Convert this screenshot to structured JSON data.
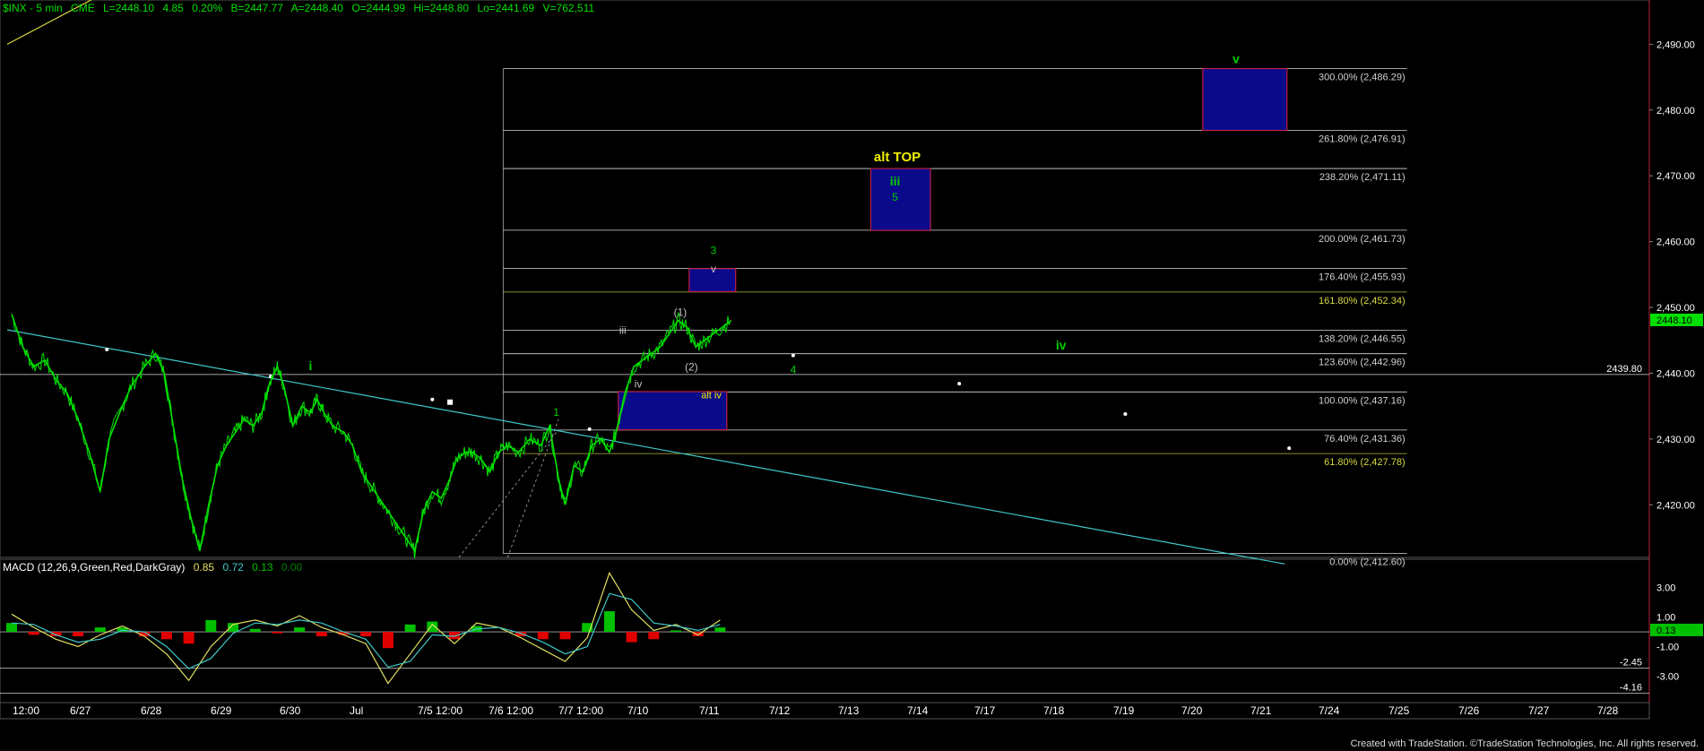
{
  "header": {
    "symbol": "$INX - 5 min",
    "exchange": "CME",
    "last": "L=2448.10",
    "change": "4.85",
    "pct": "0.20%",
    "bid": "B=2447.77",
    "ask": "A=2448.40",
    "open": "O=2444.99",
    "high": "Hi=2448.80",
    "low": "Lo=2441.69",
    "volume": "V=762,511"
  },
  "macd_header": {
    "label": "MACD (12,26,9,Green,Red,DarkGray)",
    "v1": "0.85",
    "v2": "0.72",
    "v3": "0.13",
    "v4": "0.00"
  },
  "credit": "Created with TradeStation. ©TradeStation Technologies, Inc. All rights reserved.",
  "colors": {
    "price": "#00e000",
    "trendline": "#3fc8c8",
    "yellowline": "#d8d840",
    "fib_line": "#ffffff",
    "fib_text": "#d0d0d0",
    "fib_gold": "#d8d840",
    "box_fill": "#0a0a8a",
    "box_border": "#c02040",
    "wave_green": "#00d000",
    "wave_gray": "#c0c0c0",
    "wave_yellow": "#f0f000",
    "macd_line": "#e0e060",
    "macd_signal": "#3fc8c8",
    "macd_pos": "#00c000",
    "macd_neg": "#e00000",
    "grid": "#3a3a3a",
    "price_tag": "#00e000"
  },
  "chart_data": [
    {
      "type": "line",
      "name": "price",
      "x_ticks": [
        "12:00",
        "6/27",
        "6/28",
        "6/29",
        "6/30",
        "Jul",
        "7/5 12:00",
        "7/6 12:00",
        "7/7 12:00",
        "7/10",
        "7/11",
        "7/12",
        "7/13",
        "7/14",
        "7/17",
        "7/18",
        "7/19",
        "7/20",
        "7/21",
        "7/24",
        "7/25",
        "7/26",
        "7/27",
        "7/28"
      ],
      "ylim": [
        2412,
        2494
      ],
      "y_ticks": [
        "2,420.00",
        "2,430.00",
        "2,440.00",
        "2,450.00",
        "2,460.00",
        "2,470.00",
        "2,480.00",
        "2,490.00"
      ],
      "y_tick_values": [
        2420,
        2430,
        2440,
        2450,
        2460,
        2470,
        2480,
        2490
      ],
      "last_price_tag": "2448.10",
      "last_price": 2448.1,
      "ref_tag": "2439.80",
      "ref_price": 2439.8,
      "price_path": [
        [
          0,
          2449
        ],
        [
          0.5,
          2444
        ],
        [
          1,
          2441
        ],
        [
          1.5,
          2442
        ],
        [
          2,
          2439
        ],
        [
          2.5,
          2437
        ],
        [
          3,
          2433
        ],
        [
          3.5,
          2428
        ],
        [
          4,
          2422
        ],
        [
          4.4,
          2430
        ],
        [
          5,
          2435
        ],
        [
          5.4,
          2438
        ],
        [
          6,
          2441
        ],
        [
          6.5,
          2443
        ],
        [
          6.9,
          2440
        ],
        [
          7.3,
          2432
        ],
        [
          7.7,
          2424
        ],
        [
          8.1,
          2418
        ],
        [
          8.5,
          2413
        ],
        [
          8.9,
          2420
        ],
        [
          9.3,
          2426
        ],
        [
          9.7,
          2429
        ],
        [
          10.1,
          2431
        ],
        [
          10.5,
          2433
        ],
        [
          10.9,
          2432
        ],
        [
          11.3,
          2434
        ],
        [
          11.6,
          2438
        ],
        [
          12.0,
          2441
        ],
        [
          12.3,
          2438
        ],
        [
          12.7,
          2432
        ],
        [
          13.1,
          2435
        ],
        [
          13.5,
          2434
        ],
        [
          13.8,
          2436
        ],
        [
          14.1,
          2434
        ],
        [
          14.5,
          2432
        ],
        [
          15.0,
          2431
        ],
        [
          15.4,
          2429
        ],
        [
          15.8,
          2425
        ],
        [
          16.2,
          2423
        ],
        [
          16.6,
          2421
        ],
        [
          17.0,
          2419
        ],
        [
          17.4,
          2417
        ],
        [
          17.8,
          2415
        ],
        [
          18.2,
          2413
        ],
        [
          18.6,
          2419
        ],
        [
          19.0,
          2422
        ],
        [
          19.4,
          2421
        ],
        [
          19.8,
          2424
        ],
        [
          20.1,
          2427
        ],
        [
          20.5,
          2428
        ],
        [
          20.8,
          2428
        ],
        [
          21.2,
          2427
        ],
        [
          21.6,
          2425
        ],
        [
          22.0,
          2428
        ],
        [
          22.4,
          2429
        ],
        [
          22.9,
          2428
        ],
        [
          23.4,
          2430
        ],
        [
          23.9,
          2429
        ],
        [
          24.3,
          2432
        ],
        [
          24.7,
          2424
        ],
        [
          25.0,
          2420
        ],
        [
          25.4,
          2426
        ],
        [
          25.8,
          2425
        ],
        [
          26.2,
          2429
        ],
        [
          26.6,
          2430
        ],
        [
          27.0,
          2428
        ],
        [
          27.3,
          2431
        ],
        [
          27.7,
          2437
        ],
        [
          28.1,
          2441
        ],
        [
          28.5,
          2442
        ],
        [
          28.9,
          2443
        ],
        [
          29.3,
          2444
        ],
        [
          29.7,
          2446
        ],
        [
          30.1,
          2448
        ],
        [
          30.5,
          2447
        ],
        [
          30.9,
          2444
        ],
        [
          31.3,
          2445
        ],
        [
          31.7,
          2446
        ],
        [
          32.1,
          2447
        ],
        [
          32.5,
          2448
        ]
      ],
      "yellow_line": [
        [
          -0.2,
          2490
        ],
        [
          15,
          2517
        ]
      ],
      "trendline": [
        [
          -0.2,
          2446.6
        ],
        [
          57.5,
          2411
        ]
      ],
      "trend_dots": [
        [
          4.3,
          2443.6
        ],
        [
          11.7,
          2439.5
        ],
        [
          19,
          2436
        ],
        [
          26.1,
          2431.5
        ],
        [
          35.3,
          2442.7
        ],
        [
          42.8,
          2438.4
        ],
        [
          50.3,
          2433.8
        ],
        [
          57.7,
          2428.6
        ]
      ],
      "white_square": [
        19.8,
        2435.6
      ],
      "dashed_lines": [
        [
          [
            20.2,
            2412
          ],
          [
            24.6,
            2431
          ]
        ],
        [
          [
            22.4,
            2412
          ],
          [
            24.7,
            2433
          ]
        ]
      ],
      "fib_left_x": 22.2,
      "fib_right_x": 61.2,
      "fib_levels": [
        {
          "label": "300.00% (2,486.29)",
          "price": 2486.29,
          "gold": false
        },
        {
          "label": "261.80% (2,476.91)",
          "price": 2476.91,
          "gold": false
        },
        {
          "label": "238.20% (2,471.11)",
          "price": 2471.11,
          "gold": false
        },
        {
          "label": "200.00% (2,461.73)",
          "price": 2461.73,
          "gold": false
        },
        {
          "label": "176.40% (2,455.93)",
          "price": 2455.93,
          "gold": false
        },
        {
          "label": "161.80% (2,452.34)",
          "price": 2452.34,
          "gold": true
        },
        {
          "label": "138.20% (2,446.55)",
          "price": 2446.55,
          "gold": false
        },
        {
          "label": "123.60% (2,442.96)",
          "price": 2442.96,
          "gold": false
        },
        {
          "label": "100.00% (2,437.16)",
          "price": 2437.16,
          "gold": false
        },
        {
          "label": "76.40% (2,431.36)",
          "price": 2431.36,
          "gold": false
        },
        {
          "label": "61.80% (2,427.78)",
          "price": 2427.78,
          "gold": true
        },
        {
          "label": "0.00% (2,412.60)",
          "price": 2412.6,
          "gold": false
        }
      ],
      "boxes": [
        {
          "x1": 30.6,
          "x2": 32.7,
          "y1": 2452.4,
          "y2": 2455.9
        },
        {
          "x1": 38.8,
          "x2": 41.5,
          "y1": 2461.7,
          "y2": 2471.1
        },
        {
          "x1": 53.8,
          "x2": 57.6,
          "y1": 2476.9,
          "y2": 2486.3
        },
        {
          "x1": 27.4,
          "x2": 32.3,
          "y1": 2431.4,
          "y2": 2437.2
        }
      ],
      "wave_labels": [
        {
          "text": "i",
          "x": 13.5,
          "y": 2440.5,
          "color": "green",
          "size": 14,
          "bold": true
        },
        {
          "text": "1",
          "x": 24.6,
          "y": 2433.5,
          "color": "green",
          "size": 12,
          "bold": false
        },
        {
          "text": "iii",
          "x": 27.6,
          "y": 2446,
          "color": "gray",
          "size": 12,
          "bold": false
        },
        {
          "text": "iv",
          "x": 28.3,
          "y": 2437.8,
          "color": "gray",
          "size": 12,
          "bold": false
        },
        {
          "text": "(1)",
          "x": 30.2,
          "y": 2448.7,
          "color": "gray",
          "size": 12,
          "bold": false
        },
        {
          "text": "(2)",
          "x": 30.7,
          "y": 2440.4,
          "color": "gray",
          "size": 12,
          "bold": false
        },
        {
          "text": "3",
          "x": 31.7,
          "y": 2458.1,
          "color": "green",
          "size": 12,
          "bold": false
        },
        {
          "text": "v",
          "x": 31.7,
          "y": 2455.3,
          "color": "gray",
          "size": 12,
          "bold": false
        },
        {
          "text": "alt iv",
          "x": 31.6,
          "y": 2436.2,
          "color": "yellow",
          "size": 11,
          "bold": false
        },
        {
          "text": "4",
          "x": 35.3,
          "y": 2440,
          "color": "green",
          "size": 12,
          "bold": false
        },
        {
          "text": "alt TOP",
          "x": 40.0,
          "y": 2472.2,
          "color": "yellow",
          "size": 15,
          "bold": true
        },
        {
          "text": "iii",
          "x": 39.9,
          "y": 2468.5,
          "color": "green",
          "size": 14,
          "bold": true
        },
        {
          "text": "5",
          "x": 39.9,
          "y": 2466.2,
          "color": "green",
          "size": 12,
          "bold": false
        },
        {
          "text": "iv",
          "x": 47.4,
          "y": 2443.6,
          "color": "green",
          "size": 14,
          "bold": true
        },
        {
          "text": "v",
          "x": 55.3,
          "y": 2487.1,
          "color": "green",
          "size": 14,
          "bold": true
        }
      ]
    },
    {
      "type": "line",
      "name": "MACD",
      "ylim": [
        -4.8,
        4.2
      ],
      "y_ticks": [
        "3.00",
        "1.00",
        "-1.00",
        "-3.00"
      ],
      "y_tick_values": [
        3,
        1,
        -1,
        -3
      ],
      "level_tags": [
        {
          "label": "-2.45",
          "value": -2.45
        },
        {
          "label": "-4.16",
          "value": -4.16
        }
      ],
      "value_tag": "0.13",
      "value": 0.13,
      "macd_path": [
        [
          0,
          1.2
        ],
        [
          1,
          0.3
        ],
        [
          2,
          -0.5
        ],
        [
          3,
          -1.0
        ],
        [
          4,
          -0.2
        ],
        [
          5,
          0.4
        ],
        [
          6,
          -0.3
        ],
        [
          7,
          -1.5
        ],
        [
          8,
          -3.3
        ],
        [
          9,
          -1.0
        ],
        [
          10,
          0.5
        ],
        [
          11,
          0.8
        ],
        [
          12,
          0.4
        ],
        [
          13,
          1.1
        ],
        [
          14,
          0.3
        ],
        [
          15,
          -0.2
        ],
        [
          16,
          -0.8
        ],
        [
          17,
          -3.5
        ],
        [
          18,
          -1.5
        ],
        [
          19,
          0.5
        ],
        [
          20,
          -0.8
        ],
        [
          21,
          0.6
        ],
        [
          22,
          0.3
        ],
        [
          23,
          -0.4
        ],
        [
          24,
          -1.2
        ],
        [
          25,
          -2.0
        ],
        [
          26,
          -0.4
        ],
        [
          27,
          4.0
        ],
        [
          28,
          1.5
        ],
        [
          29,
          0.1
        ],
        [
          30,
          0.5
        ],
        [
          31,
          -0.2
        ],
        [
          32,
          0.8
        ]
      ],
      "signal_path": [
        [
          0,
          0.6
        ],
        [
          1,
          0.5
        ],
        [
          2,
          -0.2
        ],
        [
          3,
          -0.7
        ],
        [
          4,
          -0.5
        ],
        [
          5,
          0.1
        ],
        [
          6,
          0.0
        ],
        [
          7,
          -1.0
        ],
        [
          8,
          -2.5
        ],
        [
          9,
          -1.8
        ],
        [
          10,
          -0.1
        ],
        [
          11,
          0.6
        ],
        [
          12,
          0.5
        ],
        [
          13,
          0.8
        ],
        [
          14,
          0.6
        ],
        [
          15,
          0.0
        ],
        [
          16,
          -0.5
        ],
        [
          17,
          -2.4
        ],
        [
          18,
          -2.0
        ],
        [
          19,
          -0.2
        ],
        [
          20,
          -0.3
        ],
        [
          21,
          0.2
        ],
        [
          22,
          0.3
        ],
        [
          23,
          -0.1
        ],
        [
          24,
          -0.7
        ],
        [
          25,
          -1.5
        ],
        [
          26,
          -1.0
        ],
        [
          27,
          2.6
        ],
        [
          28,
          2.2
        ],
        [
          29,
          0.6
        ],
        [
          30,
          0.4
        ],
        [
          31,
          0.1
        ],
        [
          32,
          0.5
        ]
      ]
    }
  ]
}
